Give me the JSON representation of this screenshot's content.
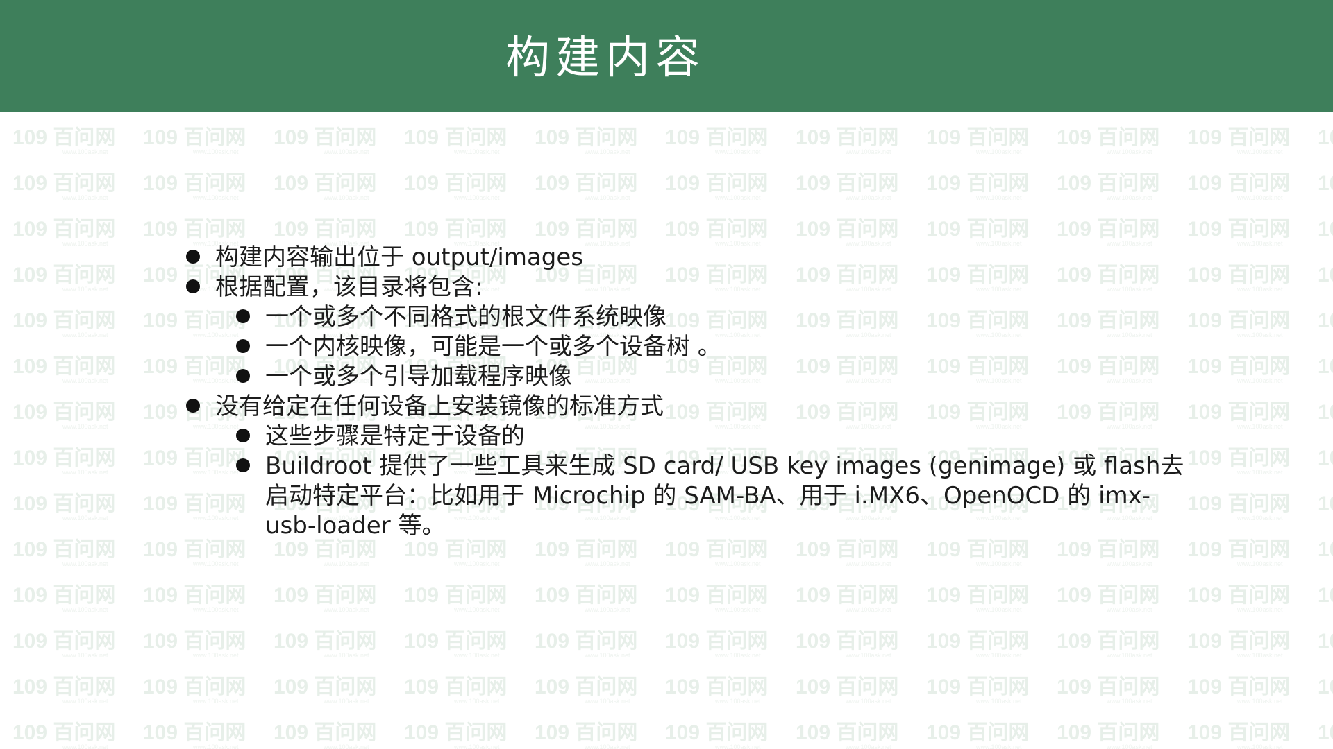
{
  "slide": {
    "title": "构建内容",
    "header_color": "#3e7f5b",
    "watermark_text": "109 百问网"
  },
  "bullets": [
    {
      "level": 1,
      "text": "构建内容输出位于 output/images"
    },
    {
      "level": 1,
      "text": "根据配置，该目录将包含:"
    },
    {
      "level": 2,
      "text": "一个或多个不同格式的根文件系统映像"
    },
    {
      "level": 2,
      "text": "一个内核映像，可能是一个或多个设备树 。"
    },
    {
      "level": 2,
      "text": "一个或多个引导加载程序映像"
    },
    {
      "level": 1,
      "text": "没有给定在任何设备上安装镜像的标准方式"
    },
    {
      "level": 2,
      "text": "这些步骤是特定于设备的"
    },
    {
      "level": 2,
      "text": "Buildroot 提供了一些工具来生成 SD card/ USB key images (genimage) 或 flash去启动特定平台：比如用于 Microchip 的 SAM-BA、用于 i.MX6、OpenOCD 的 imx-usb-loader 等。"
    }
  ]
}
